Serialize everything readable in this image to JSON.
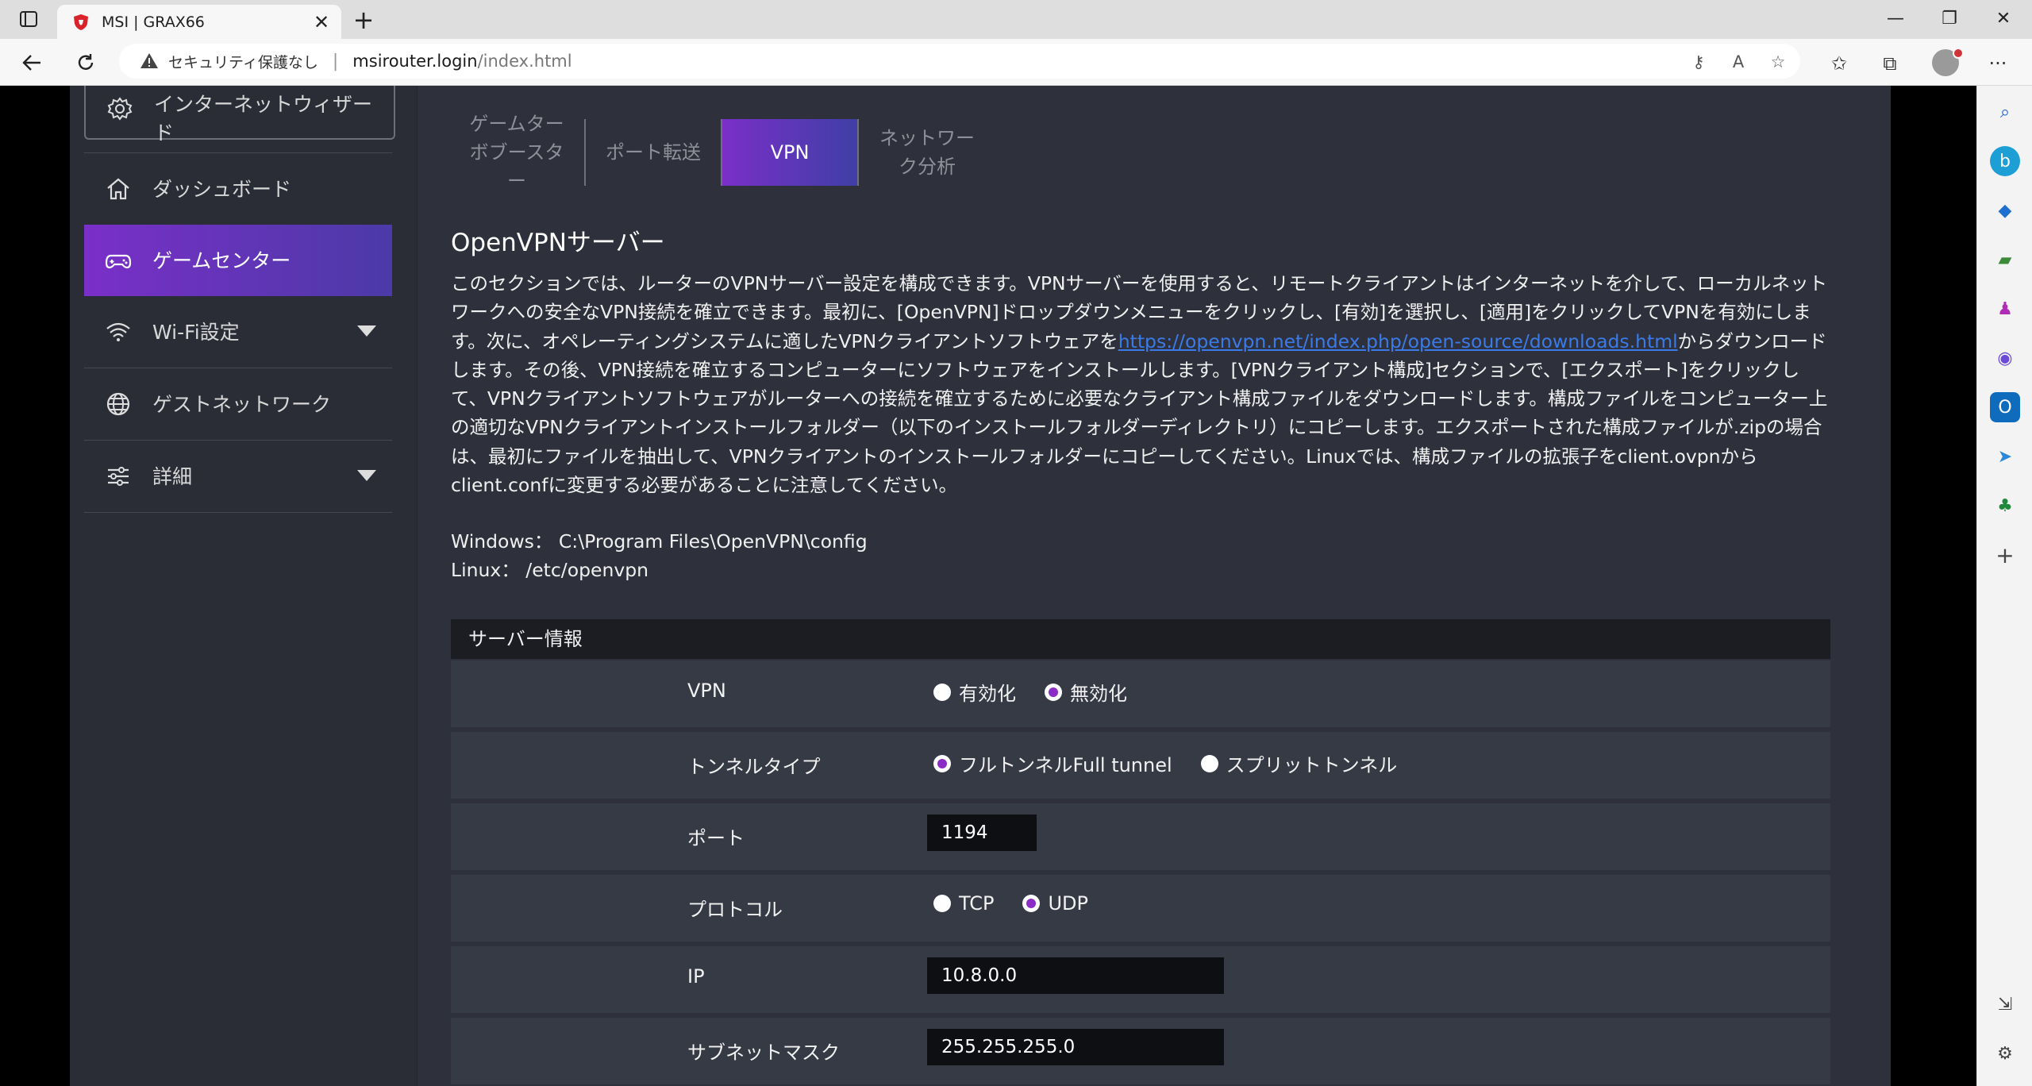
{
  "browser": {
    "tab_title": "MSI | GRAX66",
    "new_tab_symbol": "+",
    "url_warning": "セキュリティ保護なし",
    "url_host": "msirouter.login",
    "url_path": "/index.html",
    "window_controls": [
      "—",
      "❐",
      "✕"
    ]
  },
  "sidebar": {
    "wizard_label": "インターネットウィザード",
    "items": [
      {
        "label": "ダッシュボード",
        "icon": "home-icon"
      },
      {
        "label": "ゲームセンター",
        "icon": "gamepad-icon",
        "active": true
      },
      {
        "label": "Wi-Fi設定",
        "icon": "wifi-icon",
        "expandable": true
      },
      {
        "label": "ゲストネットワーク",
        "icon": "globe-icon"
      },
      {
        "label": "詳細",
        "icon": "sliders-icon",
        "expandable": true
      }
    ]
  },
  "subtabs": [
    {
      "label": "ゲームターボブースター"
    },
    {
      "label": "ポート転送"
    },
    {
      "label": "VPN",
      "active": true
    },
    {
      "label": "ネットワーク分析"
    }
  ],
  "content": {
    "title": "OpenVPNサーバー",
    "desc_part1": "このセクションでは、ルーターのVPNサーバー設定を構成できます。VPNサーバーを使用すると、リモートクライアントはインターネットを介して、ローカルネットワークへの安全なVPN接続を確立できます。最初に、[OpenVPN]ドロップダウンメニューをクリックし、[有効]を選択し、[適用]をクリックしてVPNを有効にします。次に、オペレーティングシステムに適したVPNクライアントソフトウェアを",
    "desc_link": "https://openvpn.net/index.php/open-source/downloads.html",
    "desc_part2": "からダウンロードします。その後、VPN接続を確立するコンピューターにソフトウェアをインストールします。[VPNクライアント構成]セクションで、[エクスポート]をクリックして、VPNクライアントソフトウェアがルーターへの接続を確立するために必要なクライアント構成ファイルをダウンロードします。構成ファイルをコンピューター上の適切なVPNクライアントインストールフォルダー（以下のインストールフォルダーディレクトリ）にコピーします。エクスポートされた構成ファイルが.zipの場合は、最初にファイルを抽出して、VPNクライアントのインストールフォルダーにコピーしてください。Linuxでは、構成ファイルの拡張子をclient.ovpnからclient.confに変更する必要があることに注意してください。",
    "windows_path": "Windows： C:\\Program Files\\OpenVPN\\config",
    "linux_path": "Linux： /etc/openvpn"
  },
  "server_info": {
    "header": "サーバー情報",
    "vpn": {
      "label": "VPN",
      "options": [
        "有効化",
        "無効化"
      ],
      "selected": "無効化"
    },
    "tunnel": {
      "label": "トンネルタイプ",
      "options": [
        "フルトンネルFull tunnel",
        "スプリットトンネル"
      ],
      "selected": "フルトンネルFull tunnel"
    },
    "port": {
      "label": "ポート",
      "value": "1194"
    },
    "protocol": {
      "label": "プロトコル",
      "options": [
        "TCP",
        "UDP"
      ],
      "selected": "UDP"
    },
    "ip": {
      "label": "IP",
      "value": "10.8.0.0"
    },
    "subnet": {
      "label": "サブネットマスク",
      "value": "255.255.255.0"
    }
  },
  "colors": {
    "accent_gradient_start": "#7a2fc8",
    "accent_gradient_end": "#4b3aa7",
    "radio_selected": "#8b2cc6",
    "link": "#3a7be8"
  }
}
